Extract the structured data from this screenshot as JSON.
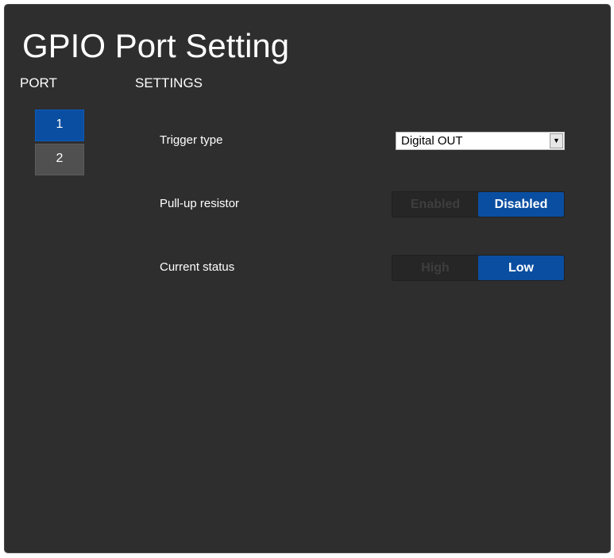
{
  "page": {
    "title": "GPIO Port Setting"
  },
  "columns": {
    "port": "PORT",
    "settings": "SETTINGS"
  },
  "ports": [
    {
      "label": "1",
      "selected": true
    },
    {
      "label": "2",
      "selected": false
    }
  ],
  "settings": {
    "trigger_type": {
      "label": "Trigger type",
      "value": "Digital OUT"
    },
    "pull_up_resistor": {
      "label": "Pull-up resistor",
      "options": [
        "Enabled",
        "Disabled"
      ],
      "selected": "Disabled"
    },
    "current_status": {
      "label": "Current status",
      "options": [
        "High",
        "Low"
      ],
      "selected": "Low"
    }
  },
  "colors": {
    "panel_bg": "#2e2e2e",
    "accent": "#0a4ea1",
    "inactive_button": "#505050"
  },
  "icons": {
    "dropdown": "chevron-down-icon"
  }
}
